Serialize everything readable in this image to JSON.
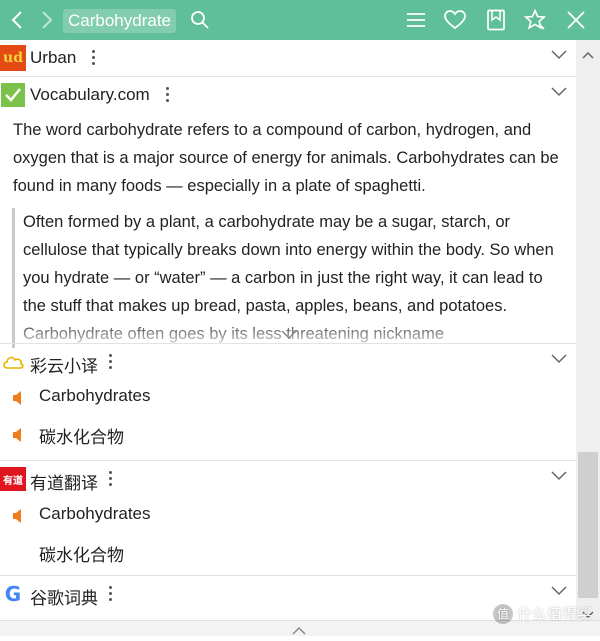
{
  "toolbar": {
    "title": "Carbohydrate",
    "icons": [
      "back-icon",
      "forward-icon",
      "search-icon",
      "menu-icon",
      "heart-icon",
      "bookmark-icon",
      "pin-icon",
      "close-icon"
    ],
    "accent": "#5fbf9a"
  },
  "dictionaries": {
    "urban": {
      "name": "Urban",
      "logo_text": "ud"
    },
    "vocabulary": {
      "name": "Vocabulary.com",
      "short_def": "The word carbohydrate refers to a compound of carbon, hydrogen, and oxygen that is a major source of energy for animals. Carbohydrates can be found in many foods — especially in a plate of spaghetti.",
      "long_def": "Often formed by a plant, a carbohydrate may be a sugar, starch, or cellulose that typically breaks down into energy within the body. So when you hydrate — or “water” — a carbon in just the right way, it can lead to the stuff that makes up bread, pasta, apples, beans, and potatoes. Carbohydrate often goes by its less threatening nickname"
    },
    "caiyun": {
      "name": "彩云小译",
      "results": [
        "Carbohydrates",
        "碳水化合物"
      ]
    },
    "youdao": {
      "name": "有道翻译",
      "logo_text": "有道",
      "results": [
        "Carbohydrates",
        "碳水化合物"
      ]
    },
    "google": {
      "name": "谷歌词典",
      "logo_text": "G"
    }
  },
  "watermark": {
    "badge": "值",
    "text": "什么值得买"
  }
}
